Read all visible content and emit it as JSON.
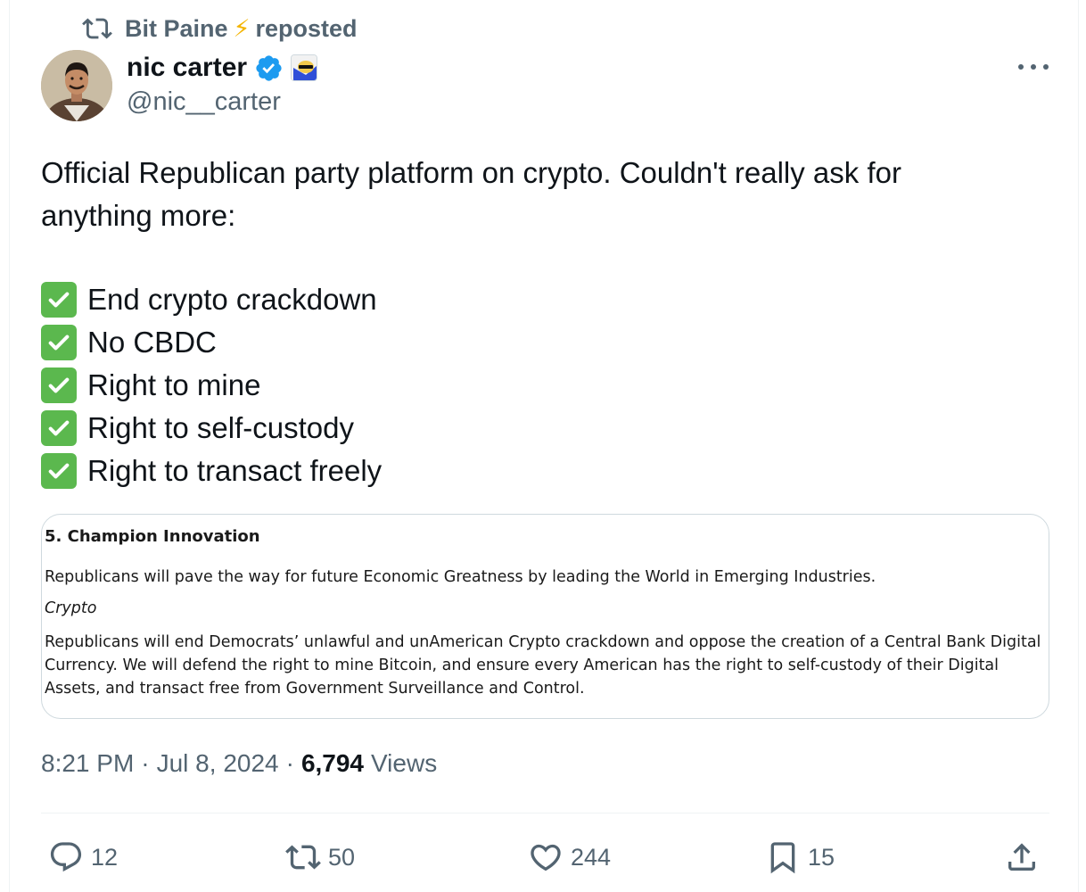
{
  "repost": {
    "user": "Bit Paine",
    "emoji": "⚡",
    "label": "reposted"
  },
  "author": {
    "name": "nic carter",
    "handle": "@nic__carter"
  },
  "tweet": {
    "line1": "Official Republican party platform on crypto. Couldn't really ask for",
    "line2": "anything more:",
    "checklist": [
      "End crypto crackdown",
      "No CBDC",
      "Right to mine",
      "Right to self-custody",
      "Right to transact freely"
    ]
  },
  "card": {
    "heading": "5. Champion Innovation",
    "para1": "Republicans will pave the way for future Economic Greatness by leading the World in Emerging Industries.",
    "subheading": "Crypto",
    "para2": "Republicans will end Democrats’ unlawful and unAmerican Crypto crackdown and oppose the creation of a Central Bank Digital Currency. We will defend the right to mine Bitcoin, and ensure every American has the right to self-custody of their Digital Assets, and transact free from Government Surveillance and Control."
  },
  "meta": {
    "time": "8:21 PM",
    "date": "Jul 8, 2024",
    "views": "6,794",
    "views_label": "Views",
    "dot": "·"
  },
  "actions": {
    "replies": "12",
    "reposts": "50",
    "likes": "244",
    "bookmarks": "15"
  },
  "colors": {
    "secondary": "#536471",
    "verified": "#1d9bf0",
    "check": "#5bb84e"
  }
}
